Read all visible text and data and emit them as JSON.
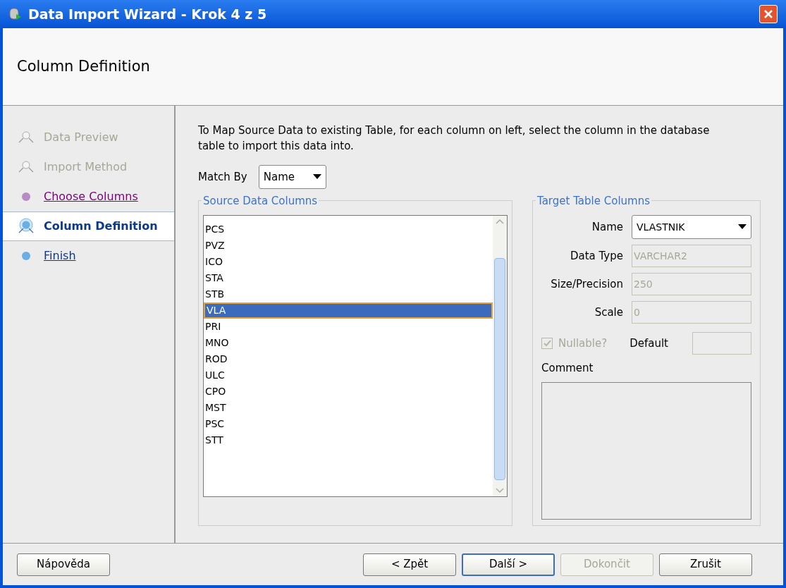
{
  "window": {
    "title": "Data Import Wizard - Krok 4 z 5"
  },
  "header": {
    "title": "Column Definition"
  },
  "steps": [
    {
      "label": "Data Preview",
      "kind": "disabled",
      "selected": false
    },
    {
      "label": "Import Method",
      "kind": "disabled",
      "selected": false
    },
    {
      "label": "Choose Columns",
      "kind": "visited",
      "selected": false
    },
    {
      "label": "Column Definition",
      "kind": "current",
      "selected": true
    },
    {
      "label": "Finish",
      "kind": "link",
      "selected": false
    }
  ],
  "instructions": "To Map Source Data to existing Table, for each column on left, select the column in the database table to import this data into.",
  "match_by": {
    "label": "Match By",
    "value": "Name"
  },
  "source": {
    "title": "Source Data Columns",
    "items": [
      {
        "label": "PCS",
        "selected": false
      },
      {
        "label": "PVZ",
        "selected": false
      },
      {
        "label": "ICO",
        "selected": false
      },
      {
        "label": "STA",
        "selected": false
      },
      {
        "label": "STB",
        "selected": false
      },
      {
        "label": "VLA",
        "selected": true
      },
      {
        "label": "PRI",
        "selected": false
      },
      {
        "label": "MNO",
        "selected": false
      },
      {
        "label": "ROD",
        "selected": false
      },
      {
        "label": "ULC",
        "selected": false
      },
      {
        "label": "CPO",
        "selected": false
      },
      {
        "label": "MST",
        "selected": false
      },
      {
        "label": "PSC",
        "selected": false
      },
      {
        "label": "STT",
        "selected": false
      }
    ]
  },
  "target": {
    "title": "Target Table Columns",
    "name_label": "Name",
    "name_value": "VLASTNIK",
    "fields": [
      {
        "label": "Data Type",
        "value": "VARCHAR2",
        "disabled": true
      },
      {
        "label": "Size/Precision",
        "value": "250",
        "disabled": true
      },
      {
        "label": "Scale",
        "value": "0",
        "disabled": true
      }
    ],
    "nullable": {
      "label": "Nullable?",
      "checked": true,
      "disabled": true
    },
    "default_label": "Default",
    "comment_label": "Comment"
  },
  "buttons": [
    {
      "label": "Nápověda",
      "kind": "help",
      "disabled": false,
      "focused": false
    },
    {
      "label": "< Zpět",
      "kind": "nav",
      "disabled": false,
      "focused": false
    },
    {
      "label": "Další >",
      "kind": "nav",
      "disabled": false,
      "focused": true
    },
    {
      "label": "Dokončit",
      "kind": "nav",
      "disabled": true,
      "focused": false
    },
    {
      "label": "Zrušit",
      "kind": "nav",
      "disabled": false,
      "focused": false
    }
  ]
}
